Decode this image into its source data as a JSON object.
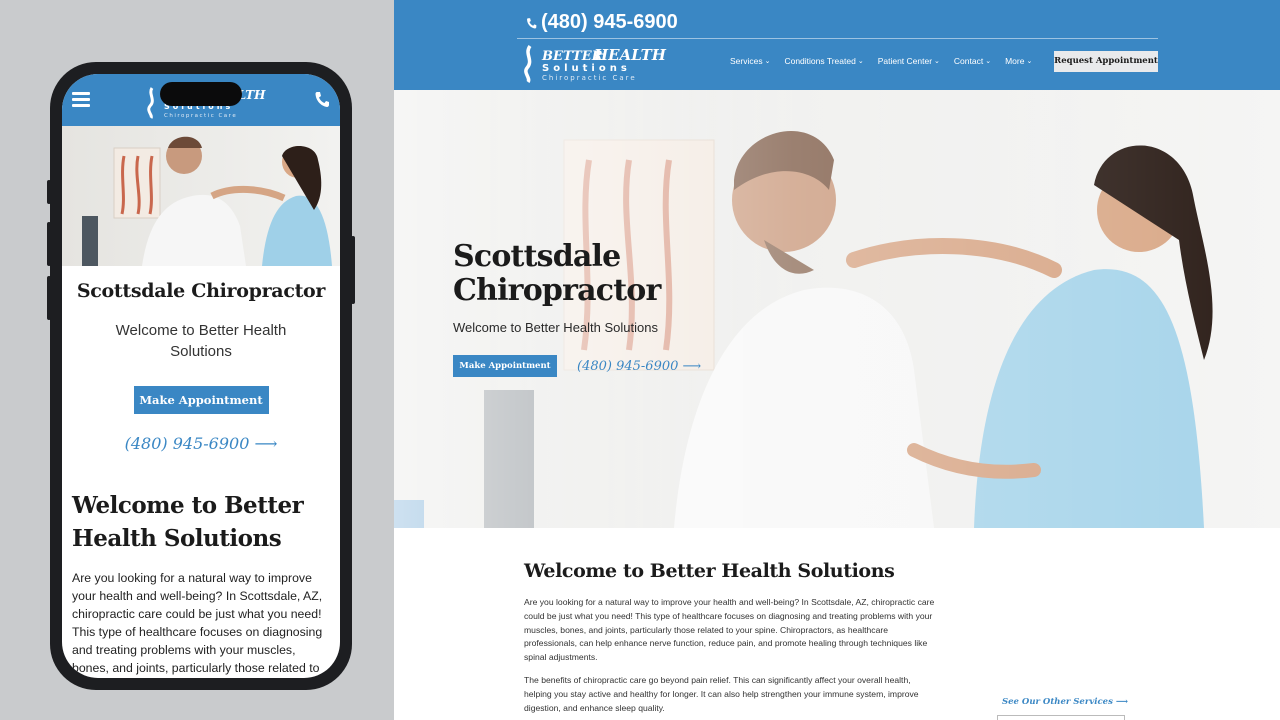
{
  "mobile": {
    "title": "Scottsdale Chiropractor",
    "subtitle": "Welcome to Better Health Solutions",
    "button_label": "Make Appointment",
    "phone": "(480) 945-6900",
    "heading": "Welcome to Better Health Solutions",
    "paragraph": "Are you looking for a natural way to improve your health and well-being? In Scottsdale, AZ, chiropractic care could be just what you need! This type of healthcare focuses on diagnosing and treating problems with your muscles, bones, and joints, particularly those related to your spine. Chiropractors, as healthcare"
  },
  "logo": {
    "line1": "BETTER",
    "line2": "HEALTH",
    "line3": "Solutions",
    "tagline": "Chiropractic Care"
  },
  "desktop": {
    "phone": "(480) 945-6900",
    "nav": [
      "Services",
      "Conditions Treated",
      "Patient Center",
      "Contact",
      "More"
    ],
    "request_label": "Request Appointment",
    "hero_title_1": "Scottsdale",
    "hero_title_2": "Chiropractor",
    "hero_subtitle": "Welcome to Better Health Solutions",
    "button_label": "Make Appointment",
    "hero_phone": "(480) 945-6900",
    "heading": "Welcome to Better Health Solutions",
    "paragraph_1": "Are you looking for a natural way to improve your health and well-being? In Scottsdale, AZ, chiropractic care could be just what you need! This type of healthcare focuses on diagnosing and treating problems with your muscles, bones, and joints, particularly those related to your spine. Chiropractors, as healthcare professionals, can help enhance nerve function, reduce pain, and promote healing through techniques like spinal adjustments.",
    "paragraph_2": "The benefits of chiropractic care go beyond pain relief. This can significantly affect your overall health, helping you stay active and healthy for longer. It can also help strengthen your immune system, improve digestion, and enhance sleep quality.",
    "side_link": "See Our Other Services"
  },
  "colors": {
    "brand": "#3a87c4",
    "page_bg": "#c9cbcd"
  }
}
